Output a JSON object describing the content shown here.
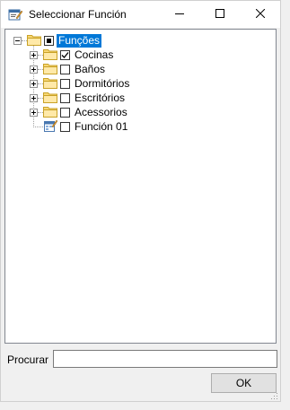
{
  "window": {
    "title": "Seleccionar Función",
    "icon": "app-form-icon",
    "controls": [
      "minimize-icon",
      "maximize-icon",
      "close-icon"
    ]
  },
  "tree": {
    "root": {
      "label": "Funções",
      "expanded": true,
      "selected": true,
      "checkbox": "indeterminate"
    },
    "children": [
      {
        "label": "Cocinas",
        "checked": true,
        "expandable": true,
        "icon": "folder-icon"
      },
      {
        "label": "Baños",
        "checked": false,
        "expandable": true,
        "icon": "folder-icon"
      },
      {
        "label": "Dormitórios",
        "checked": false,
        "expandable": true,
        "icon": "folder-icon"
      },
      {
        "label": "Escritórios",
        "checked": false,
        "expandable": true,
        "icon": "folder-icon"
      },
      {
        "label": "Acessorios",
        "checked": false,
        "expandable": true,
        "icon": "folder-icon"
      },
      {
        "label": "Función 01",
        "checked": false,
        "expandable": false,
        "icon": "function-item-icon"
      }
    ]
  },
  "search": {
    "label": "Procurar",
    "value": "",
    "placeholder": ""
  },
  "ok_button": {
    "label": "OK"
  },
  "colors": {
    "selection": "#0078d7",
    "folder": "#f8d775",
    "window_bg": "#f0f0f0"
  }
}
